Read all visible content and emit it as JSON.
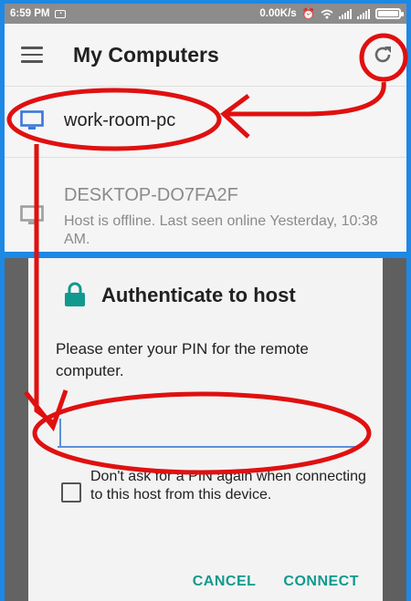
{
  "status_bar": {
    "time": "6:59 PM",
    "net_speed": "0.00K/s",
    "icons": [
      "notification-icon",
      "alarm-icon",
      "wifi-icon",
      "signal-icon",
      "signal-icon-2",
      "battery-icon"
    ]
  },
  "app_bar": {
    "title": "My Computers",
    "menu_icon": "hamburger-menu-icon",
    "refresh_icon": "refresh-icon"
  },
  "hosts": [
    {
      "name": "work-room-pc",
      "status": "",
      "online": true
    },
    {
      "name": "DESKTOP-DO7FA2F",
      "status": "Host is offline.  Last seen online Yesterday, 10:38 AM.",
      "online": false
    }
  ],
  "dialog": {
    "title": "Authenticate to host",
    "message": "Please enter your PIN for the remote computer.",
    "pin_value": "",
    "dont_ask_label": "Don't ask for a PIN again when connecting to this host from this device.",
    "dont_ask_checked": false,
    "cancel_label": "CANCEL",
    "connect_label": "CONNECT"
  },
  "colors": {
    "accent_teal": "#11998e",
    "monitor_online": "#3b78d8",
    "monitor_offline": "#9e9e9e",
    "annotation_red": "#e01010",
    "frame_blue": "#1e88e5"
  }
}
